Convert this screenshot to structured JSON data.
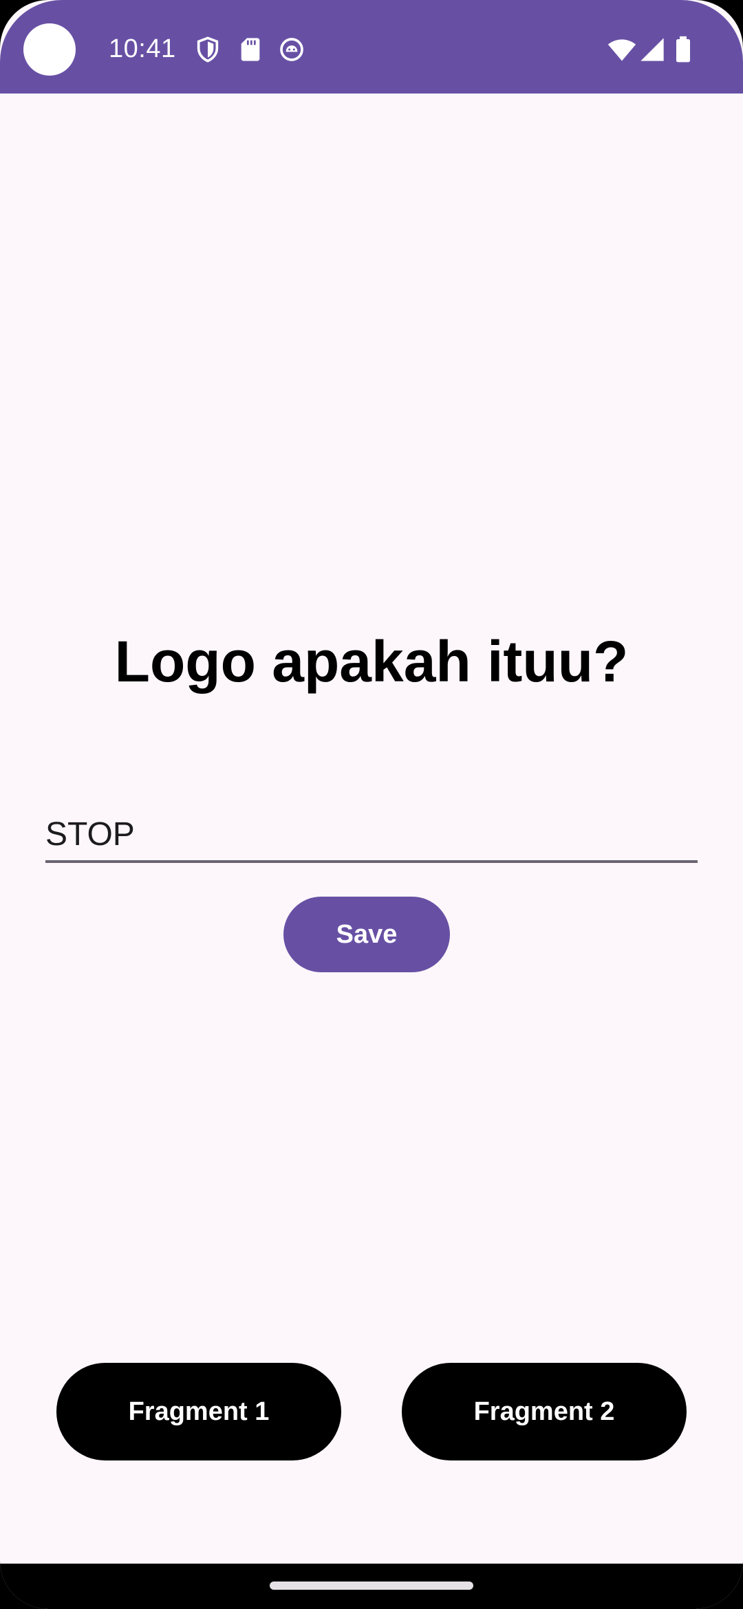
{
  "status_bar": {
    "time": "10:41",
    "color": "#6750a4",
    "left_icons": [
      "shield-icon",
      "sd-card-icon",
      "android-debug-icon"
    ],
    "right_icons": [
      "wifi-icon",
      "cellular-signal-icon",
      "battery-icon"
    ]
  },
  "main": {
    "question": "Logo apakah ituu?",
    "answer_value": "STOP",
    "answer_placeholder": "",
    "save_label": "Save",
    "accent_color": "#6750a4"
  },
  "bottom": {
    "fragment_1_label": "Fragment 1",
    "fragment_2_label": "Fragment 2"
  }
}
